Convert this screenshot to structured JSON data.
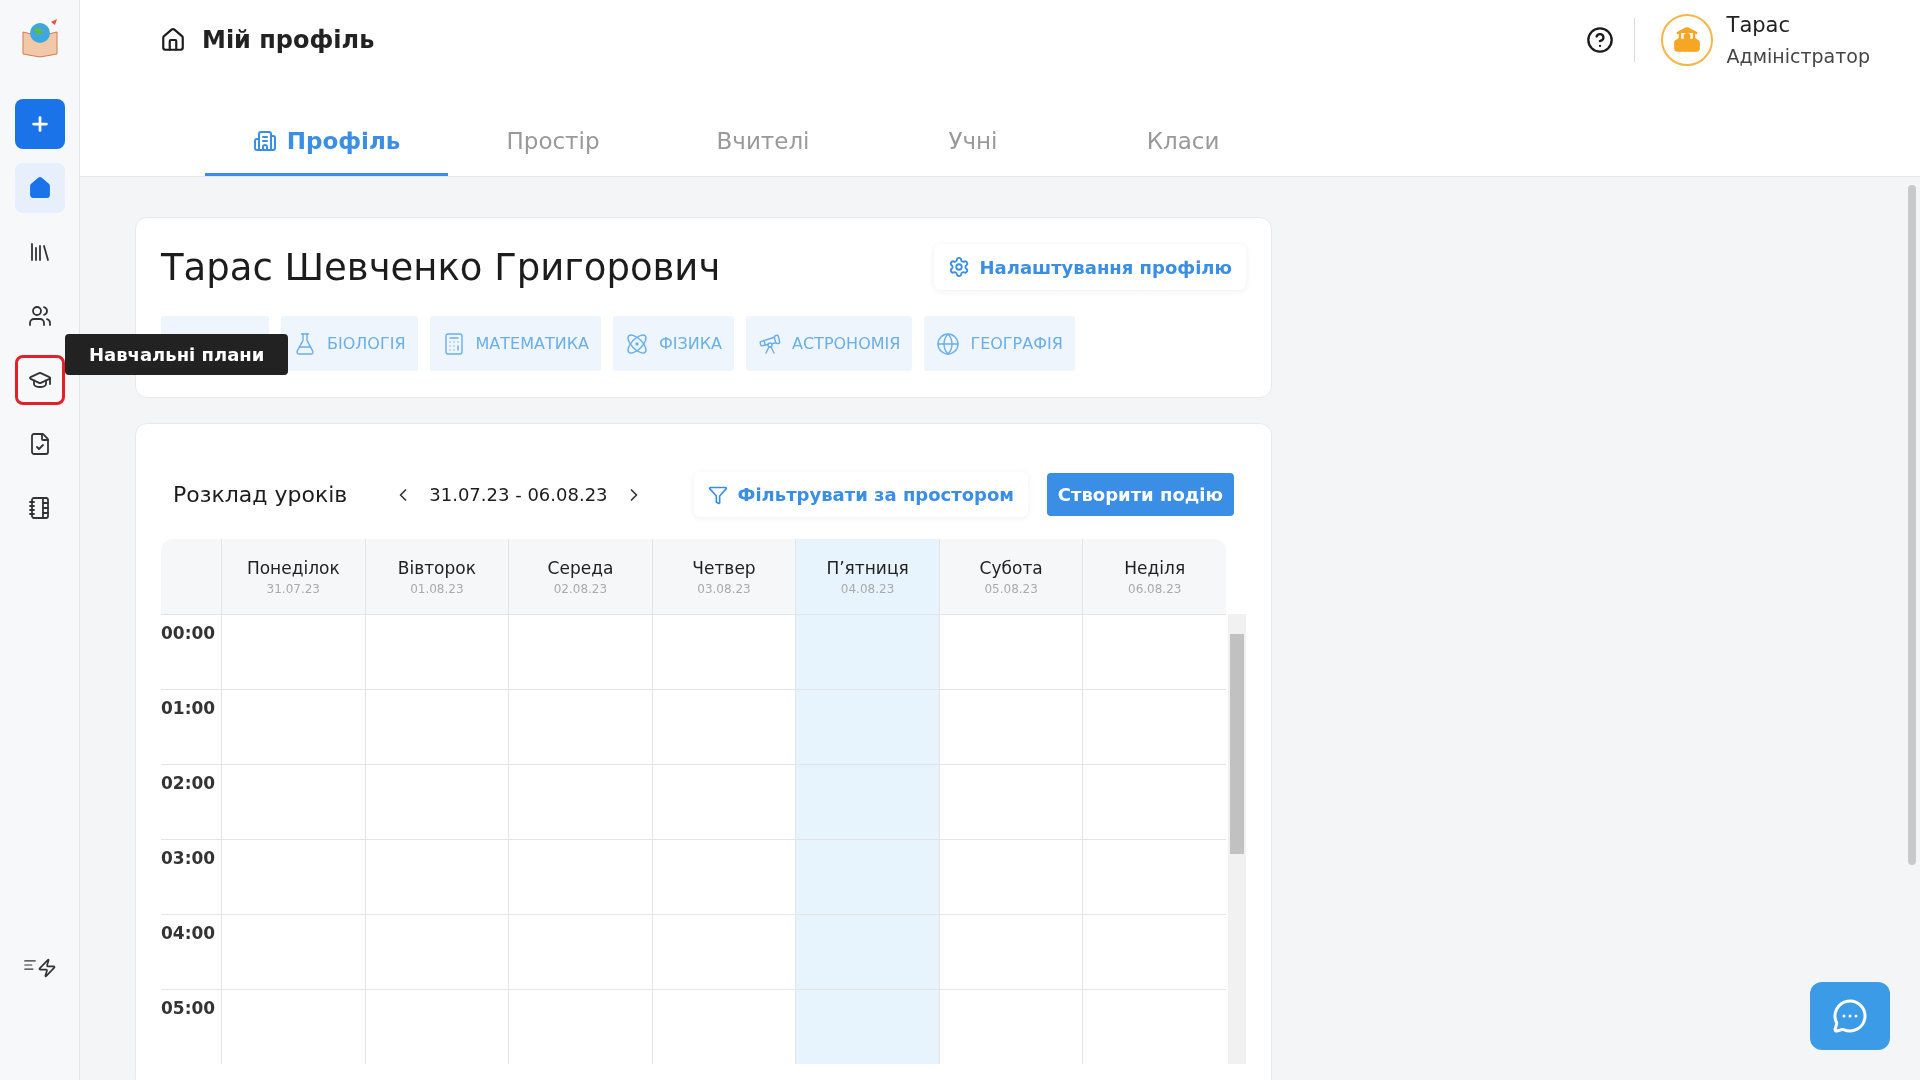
{
  "sidebar": {
    "items": [
      {
        "kind": "add",
        "selected": false,
        "highlighted": false
      },
      {
        "kind": "home",
        "selected": true,
        "highlighted": false
      },
      {
        "kind": "library",
        "selected": false,
        "highlighted": false
      },
      {
        "kind": "users",
        "selected": false,
        "highlighted": false
      },
      {
        "kind": "plans",
        "selected": false,
        "highlighted": true
      },
      {
        "kind": "tasks",
        "selected": false,
        "highlighted": false
      },
      {
        "kind": "journal",
        "selected": false,
        "highlighted": false
      }
    ],
    "tooltip": "Навчальні плани"
  },
  "header": {
    "title": "Мій профіль",
    "user": {
      "name": "Тарас",
      "role": "Адміністратор"
    }
  },
  "tabs": [
    {
      "label": "Профіль",
      "selected": true
    },
    {
      "label": "Простір",
      "selected": false
    },
    {
      "label": "Вчителі",
      "selected": false
    },
    {
      "label": "Учні",
      "selected": false
    },
    {
      "label": "Класи",
      "selected": false
    }
  ],
  "profile": {
    "name": "Тарас Шевченко Григорович",
    "settings_button": "Налаштування профілю",
    "subjects": [
      {
        "kind": "covered"
      },
      {
        "kind": "biology",
        "label": "БІОЛОГІЯ"
      },
      {
        "kind": "math",
        "label": "МАТЕМАТИКА"
      },
      {
        "kind": "physics",
        "label": "ФІЗИКА"
      },
      {
        "kind": "astronomy",
        "label": "АСТРОНОМІЯ"
      },
      {
        "kind": "geography",
        "label": "ГЕОГРАФІЯ"
      }
    ]
  },
  "schedule": {
    "title": "Розклад уроків",
    "range": "31.07.23 - 06.08.23",
    "filter_button": "Фільтрувати за простором",
    "create_button": "Створити подію",
    "days": [
      {
        "name": "Понеділок",
        "date": "31.07.23",
        "selected": false
      },
      {
        "name": "Вівторок",
        "date": "01.08.23",
        "selected": false
      },
      {
        "name": "Середа",
        "date": "02.08.23",
        "selected": false
      },
      {
        "name": "Четвер",
        "date": "03.08.23",
        "selected": false
      },
      {
        "name": "П’ятниця",
        "date": "04.08.23",
        "selected": true
      },
      {
        "name": "Субота",
        "date": "05.08.23",
        "selected": false
      },
      {
        "name": "Неділя",
        "date": "06.08.23",
        "selected": false
      }
    ],
    "hours": [
      "00:00",
      "01:00",
      "02:00",
      "03:00",
      "04:00",
      "05:00"
    ]
  }
}
